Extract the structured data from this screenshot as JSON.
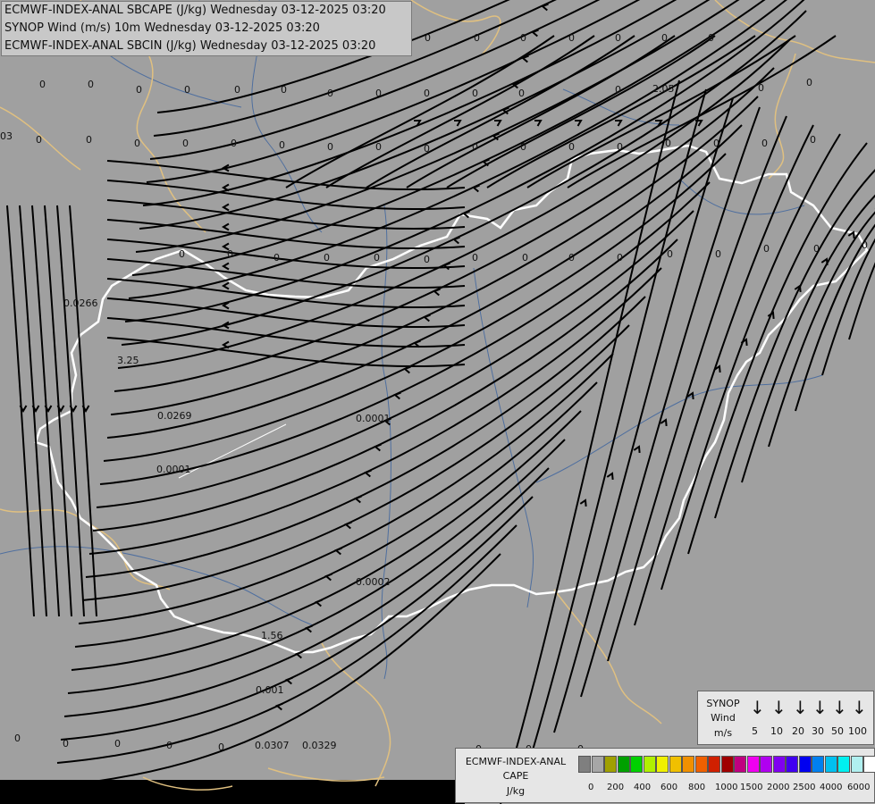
{
  "titles": [
    "ECMWF-INDEX-ANAL SBCAPE (J/kg) Wednesday 03-12-2025 03:20",
    "SYNOP Wind (m/s) 10m Wednesday 03-12-2025 03:20",
    "ECMWF-INDEX-ANAL SBCIN (J/kg) Wednesday 03-12-2025 03:20"
  ],
  "colors": {
    "background": "#a0a0a0",
    "border_country": "#ffffff",
    "border_neighbour": "#e0c080",
    "rivers": "#4f6f9f",
    "streamlines": "#000000"
  },
  "values": [
    {
      "t": "0"
    },
    {
      "t": "0"
    },
    {
      "t": "0"
    },
    {
      "t": "0"
    },
    {
      "t": "0"
    },
    {
      "t": "0"
    },
    {
      "t": "0"
    },
    {
      "t": "0"
    },
    {
      "t": "0"
    },
    {
      "t": "0"
    },
    {
      "t": "0"
    },
    {
      "t": "0"
    },
    {
      "t": "2.05"
    },
    {
      "t": "03"
    },
    {
      "t": "0.0266"
    },
    {
      "t": "3.25"
    },
    {
      "t": "0.0269"
    },
    {
      "t": "0.0001"
    },
    {
      "t": "0.0001"
    },
    {
      "t": "0.0002"
    },
    {
      "t": "1.56"
    },
    {
      "t": "0.001"
    },
    {
      "t": "0.0307"
    },
    {
      "t": "0.0329"
    },
    {
      "t": "0"
    },
    {
      "t": "0"
    },
    {
      "t": "0"
    },
    {
      "t": "0"
    },
    {
      "t": "0"
    },
    {
      "t": "0"
    },
    {
      "t": "0"
    },
    {
      "t": "0"
    },
    {
      "t": "0"
    },
    {
      "t": "0"
    },
    {
      "t": "0"
    },
    {
      "t": "0"
    },
    {
      "t": "0"
    },
    {
      "t": "0"
    },
    {
      "t": "0"
    },
    {
      "t": "0"
    },
    {
      "t": "0"
    },
    {
      "t": "0"
    },
    {
      "t": "0"
    },
    {
      "t": "0"
    },
    {
      "t": "0"
    },
    {
      "t": "0"
    },
    {
      "t": "0"
    },
    {
      "t": "0"
    },
    {
      "t": "0"
    },
    {
      "t": "0"
    },
    {
      "t": "0"
    },
    {
      "t": "0"
    },
    {
      "t": "0"
    },
    {
      "t": "0"
    },
    {
      "t": "0"
    },
    {
      "t": "0"
    },
    {
      "t": "0"
    },
    {
      "t": "0"
    },
    {
      "t": "0"
    },
    {
      "t": "0"
    },
    {
      "t": "0"
    },
    {
      "t": "0"
    },
    {
      "t": "0"
    },
    {
      "t": "0"
    },
    {
      "t": "0"
    },
    {
      "t": "0"
    },
    {
      "t": "0"
    },
    {
      "t": "0"
    },
    {
      "t": "0"
    },
    {
      "t": "0"
    },
    {
      "t": "0"
    },
    {
      "t": "0"
    },
    {
      "t": "0"
    },
    {
      "t": "0"
    },
    {
      "t": "0"
    },
    {
      "t": "0"
    },
    {
      "t": "0"
    },
    {
      "t": "0"
    }
  ],
  "wind_legend": {
    "title": [
      "SYNOP",
      "Wind",
      "m/s"
    ],
    "arrow_icon": "↓",
    "labels": [
      "5",
      "10",
      "20",
      "30",
      "50",
      "100"
    ]
  },
  "cape_legend": {
    "title": [
      "ECMWF-INDEX-ANAL",
      "CAPE",
      "J/kg"
    ],
    "colors": [
      "#7f7f7f",
      "#a6a6a6",
      "#a0a000",
      "#00a000",
      "#00d000",
      "#b0f000",
      "#f0f000",
      "#f0c000",
      "#f09000",
      "#f06000",
      "#d02000",
      "#a00000",
      "#c00080",
      "#f000f0",
      "#b000f0",
      "#8000f0",
      "#4000f0",
      "#0000f0",
      "#0080f0",
      "#00c0f0",
      "#00f0f0",
      "#b0f0f0",
      "#ffffff"
    ],
    "labels": [
      "0",
      "200",
      "400",
      "600",
      "800",
      "1000",
      "1500",
      "2000",
      "2500",
      "4000",
      "6000"
    ]
  }
}
